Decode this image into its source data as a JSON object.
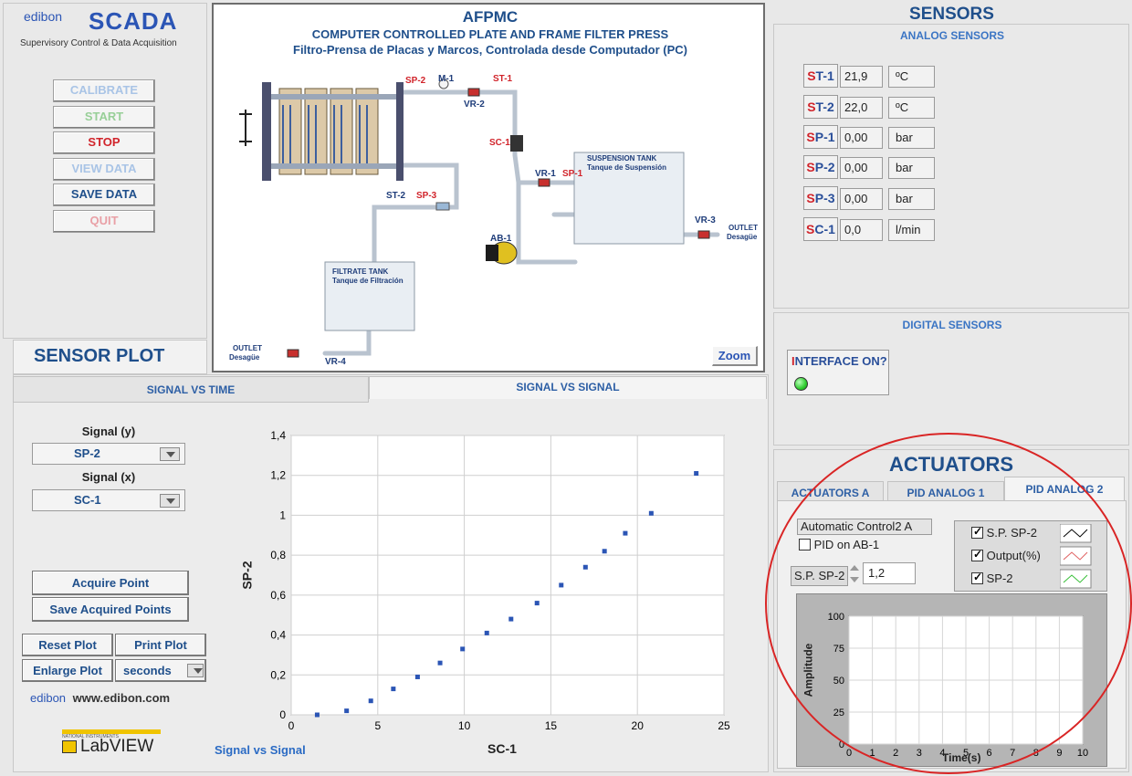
{
  "brand": {
    "edibon": "edibon",
    "scada": "SCADA",
    "subtitle": "Supervisory Control & Data Acquisition",
    "website": "www.edibon.com",
    "labview_small": "NATIONAL INSTRUMENTS",
    "labview": "LabVIEW"
  },
  "controls": {
    "calibrate": "CALIBRATE",
    "start": "START",
    "stop": "STOP",
    "view_data": "VIEW DATA",
    "save_data": "SAVE DATA",
    "quit": "QUIT"
  },
  "diagram": {
    "title": "AFPMC",
    "subtitle_en": "COMPUTER CONTROLLED PLATE AND FRAME FILTER PRESS",
    "subtitle_es": "Filtro-Prensa de Placas y Marcos, Controlada desde Computador (PC)",
    "labels": {
      "sp2": "SP-2",
      "m1": "M-1",
      "st1": "ST-1",
      "vr2": "VR-2",
      "sc1": "SC-1",
      "vr1": "VR-1",
      "sp1": "SP-1",
      "st2": "ST-2",
      "sp3": "SP-3",
      "ab1": "AB-1",
      "vr3": "VR-3",
      "vr4": "VR-4"
    },
    "suspension_tank": "SUSPENSION TANK",
    "suspension_tank_es": "Tanque de Suspensión",
    "filtrate_tank": "FILTRATE TANK",
    "filtrate_tank_es": "Tanque de Filtración",
    "outlet": "OUTLET",
    "outlet_es": "Desagüe",
    "zoom": "Zoom"
  },
  "sensors": {
    "title": "SENSORS",
    "analog_title": "ANALOG SENSORS",
    "analog": [
      {
        "tag_a": "S",
        "tag_b": "T-1",
        "value": "21,9",
        "unit": "ºC"
      },
      {
        "tag_a": "S",
        "tag_b": "T-2",
        "value": "22,0",
        "unit": "ºC"
      },
      {
        "tag_a": "S",
        "tag_b": "P-1",
        "value": "0,00",
        "unit": "bar"
      },
      {
        "tag_a": "S",
        "tag_b": "P-2",
        "value": "0,00",
        "unit": "bar"
      },
      {
        "tag_a": "S",
        "tag_b": "P-3",
        "value": "0,00",
        "unit": "bar"
      },
      {
        "tag_a": "S",
        "tag_b": "C-1",
        "value": "0,0",
        "unit": "l/min"
      }
    ],
    "digital_title": "DIGITAL SENSORS",
    "interface_a": "I",
    "interface_b": "NTERFACE ON?",
    "led_color": "#2ecc2e"
  },
  "sensor_plot": {
    "title": "SENSOR PLOT",
    "tab_time": "SIGNAL VS TIME",
    "tab_signal": "SIGNAL VS SIGNAL",
    "signal_y_label": "Signal (y)",
    "signal_y": "SP-2",
    "signal_x_label": "Signal (x)",
    "signal_x": "SC-1",
    "acquire": "Acquire Point",
    "save_acquired": "Save Acquired Points",
    "reset": "Reset Plot",
    "print": "Print Plot",
    "enlarge": "Enlarge Plot",
    "units": "seconds",
    "caption": "Signal vs Signal"
  },
  "chart_data": {
    "type": "scatter",
    "title": "",
    "xlabel": "SC-1",
    "ylabel": "SP-2",
    "xlim": [
      0,
      25
    ],
    "ylim": [
      0,
      1.4
    ],
    "xticks": [
      "0",
      "5",
      "10",
      "15",
      "20",
      "25"
    ],
    "yticks": [
      "0",
      "0,2",
      "0,4",
      "0,6",
      "0,8",
      "1",
      "1,2",
      "1,4"
    ],
    "grid": true,
    "color": "#2b55b5",
    "points": [
      {
        "x": 1.5,
        "y": 0.0
      },
      {
        "x": 3.2,
        "y": 0.02
      },
      {
        "x": 4.6,
        "y": 0.07
      },
      {
        "x": 5.9,
        "y": 0.13
      },
      {
        "x": 7.3,
        "y": 0.19
      },
      {
        "x": 8.6,
        "y": 0.26
      },
      {
        "x": 9.9,
        "y": 0.33
      },
      {
        "x": 11.3,
        "y": 0.41
      },
      {
        "x": 12.7,
        "y": 0.48
      },
      {
        "x": 14.2,
        "y": 0.56
      },
      {
        "x": 15.6,
        "y": 0.65
      },
      {
        "x": 17.0,
        "y": 0.74
      },
      {
        "x": 18.1,
        "y": 0.82
      },
      {
        "x": 19.3,
        "y": 0.91
      },
      {
        "x": 20.8,
        "y": 1.01
      },
      {
        "x": 23.4,
        "y": 1.21
      }
    ]
  },
  "actuators": {
    "title": "ACTUATORS",
    "tabs": [
      "ACTUATORS A",
      "PID ANALOG 1",
      "PID ANALOG 2"
    ],
    "auto_control": "Automatic Control2 A",
    "pid_on": "PID on AB-1",
    "sp_label": "S.P. SP-2",
    "sp_value": "1,2",
    "legend": [
      "S.P. SP-2",
      "Output(%)",
      "SP-2"
    ],
    "legend_colors": [
      "#000000",
      "#e06060",
      "#38c038"
    ],
    "amp_label": "Amplitude",
    "time_label": "Time(s)",
    "amp_ticks": [
      "100",
      "75",
      "50",
      "25",
      "0"
    ],
    "time_ticks": [
      "0",
      "1",
      "2",
      "3",
      "4",
      "5",
      "6",
      "7",
      "8",
      "9",
      "10"
    ]
  }
}
